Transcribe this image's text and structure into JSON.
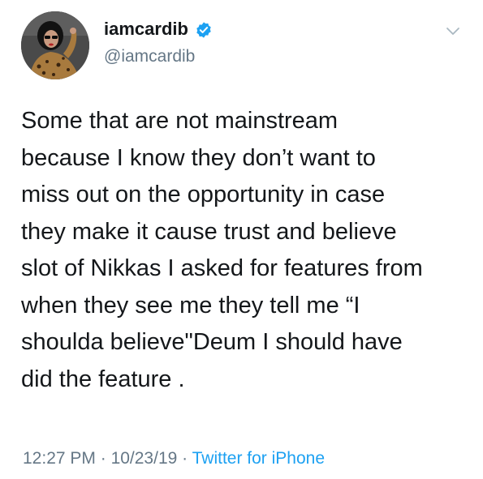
{
  "tweet": {
    "author": {
      "display_name": "iamcardib",
      "handle": "@iamcardib",
      "verified": true,
      "avatar_icon": "profile-photo",
      "verified_icon": "verified-badge-icon",
      "menu_icon": "chevron-down-icon"
    },
    "text_lines": [
      "Some that are not mainstream",
      "because I know they don’t want to",
      "miss out on the opportunity in case",
      "they make it cause trust and believe",
      "slot of Nikkas I asked for features from",
      "when they see me they tell me “I",
      "shoulda believe\"Deum I should have",
      "did the feature ."
    ],
    "time": "12:27 PM",
    "date": "10/23/19",
    "separator": " · ",
    "source": "Twitter for iPhone"
  },
  "colors": {
    "text": "#14171a",
    "secondary": "#657786",
    "link": "#1da1f2",
    "background": "#ffffff"
  }
}
